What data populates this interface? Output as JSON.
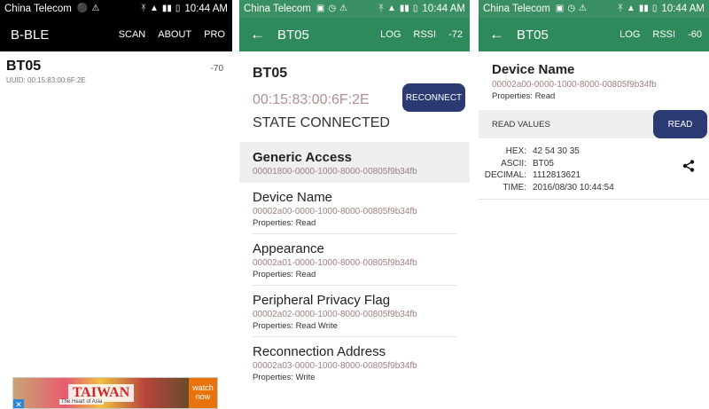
{
  "status": {
    "carrier": "China Telecom",
    "time": "10:44 AM"
  },
  "screen1": {
    "appbar": {
      "title": "B-BLE",
      "actions": [
        "SCAN",
        "ABOUT",
        "PRO"
      ]
    },
    "device": {
      "name": "BT05",
      "rssi": "-70",
      "uuid": "UUID: 00:15:83:00:6F:2E"
    },
    "ad": {
      "logo": "TAIWAN",
      "subtitle": "The Heart of Asia",
      "cta": "watch now"
    }
  },
  "screen2": {
    "appbar": {
      "title": "BT05",
      "actions": [
        "LOG",
        "RSSI",
        "-72"
      ]
    },
    "device_name": "BT05",
    "mac": "00:15:83:00:6F:2E",
    "state": "STATE CONNECTED",
    "reconnect_label": "RECONNECT",
    "service": {
      "name": "Generic Access",
      "uuid": "00001800-0000-1000-8000-00805f9b34fb"
    },
    "characteristics": [
      {
        "name": "Device Name",
        "uuid": "00002a00-0000-1000-8000-00805f9b34fb",
        "props": "Properties: Read"
      },
      {
        "name": "Appearance",
        "uuid": "00002a01-0000-1000-8000-00805f9b34fb",
        "props": "Properties: Read"
      },
      {
        "name": "Peripheral Privacy Flag",
        "uuid": "00002a02-0000-1000-8000-00805f9b34fb",
        "props": "Properties: Read Write"
      },
      {
        "name": "Reconnection Address",
        "uuid": "00002a03-0000-1000-8000-00805f9b34fb",
        "props": "Properties: Write"
      }
    ]
  },
  "screen3": {
    "appbar": {
      "title": "BT05",
      "actions": [
        "LOG",
        "RSSI",
        "-60"
      ]
    },
    "char_name": "Device Name",
    "char_uuid": "00002a00-0000-1000-8000-00805f9b34fb",
    "char_props": "Properties: Read",
    "read_values_label": "READ VALUES",
    "read_label": "READ",
    "values": [
      {
        "key": "HEX:",
        "value": "42 54 30 35"
      },
      {
        "key": "ASCII:",
        "value": "BT05"
      },
      {
        "key": "DECIMAL:",
        "value": "1112813621"
      },
      {
        "key": "TIME:",
        "value": "2016/08/30 10:44:54"
      }
    ]
  },
  "colors": {
    "toolbar_green": "#2f8a5b",
    "statusbar_green": "#3a8f63",
    "button_navy": "#2c3a73",
    "uuid_text": "#a08080"
  }
}
